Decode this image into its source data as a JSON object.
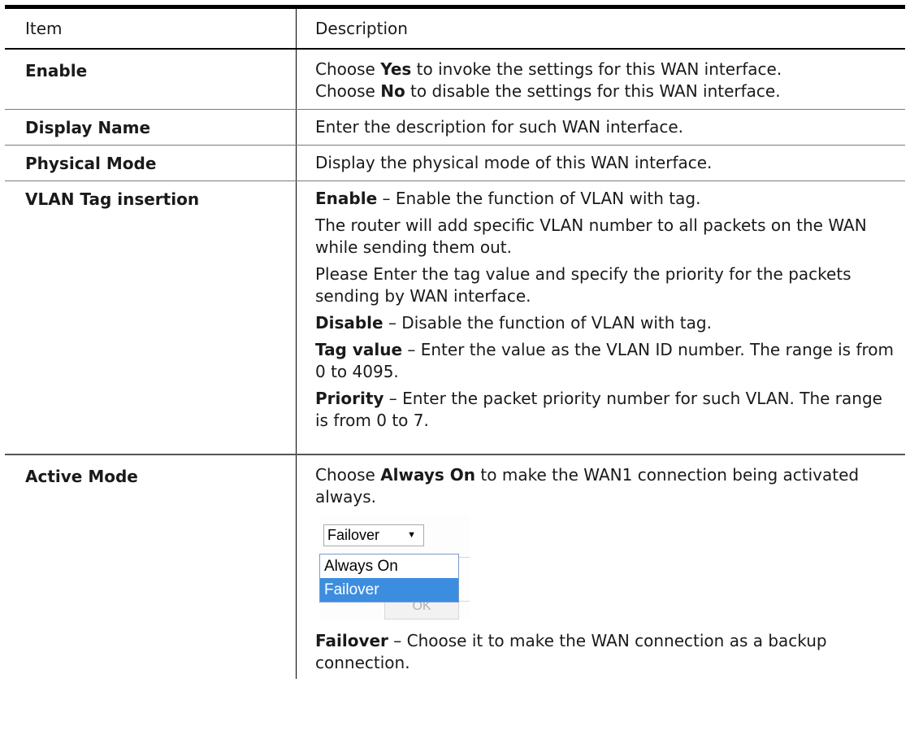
{
  "header": {
    "item": "Item",
    "description": "Description"
  },
  "rows": {
    "enable": {
      "item": "Enable",
      "p1_a": "Choose ",
      "p1_b": "Yes",
      "p1_c": " to invoke the settings for this WAN interface.",
      "p2_a": "Choose ",
      "p2_b": "No",
      "p2_c": " to disable the settings for this WAN interface."
    },
    "display_name": {
      "item": "Display Name",
      "desc": "Enter the description for such WAN interface."
    },
    "physical_mode": {
      "item": "Physical Mode",
      "desc": "Display the physical mode of this WAN interface."
    },
    "vlan": {
      "item": "VLAN Tag insertion",
      "enable_term": "Enable",
      "enable_desc": " – Enable the function of VLAN with tag.",
      "router_desc": "The router will add specific VLAN number to all packets on the WAN while sending them out.",
      "please_desc": "Please Enter the tag value and specify the priority for the packets sending by WAN interface.",
      "disable_term": "Disable",
      "disable_desc": " – Disable the function of VLAN with tag.",
      "tag_term": "Tag value",
      "tag_desc": " – Enter the value as the VLAN ID number. The range is from 0 to 4095.",
      "priority_term": "Priority",
      "priority_desc": " – Enter the packet priority number for such VLAN. The range is from 0 to 7."
    },
    "active_mode": {
      "item": "Active Mode",
      "p1_a": "Choose ",
      "p1_b": "Always On",
      "p1_c": " to make the WAN1 connection being activated always.",
      "dropdown": {
        "selected": "Failover",
        "options": [
          "Always On",
          "Failover"
        ],
        "button_fragment": "OK"
      },
      "failover_term": "Failover",
      "failover_desc": " – Choose it to make the WAN connection as a backup connection."
    }
  }
}
